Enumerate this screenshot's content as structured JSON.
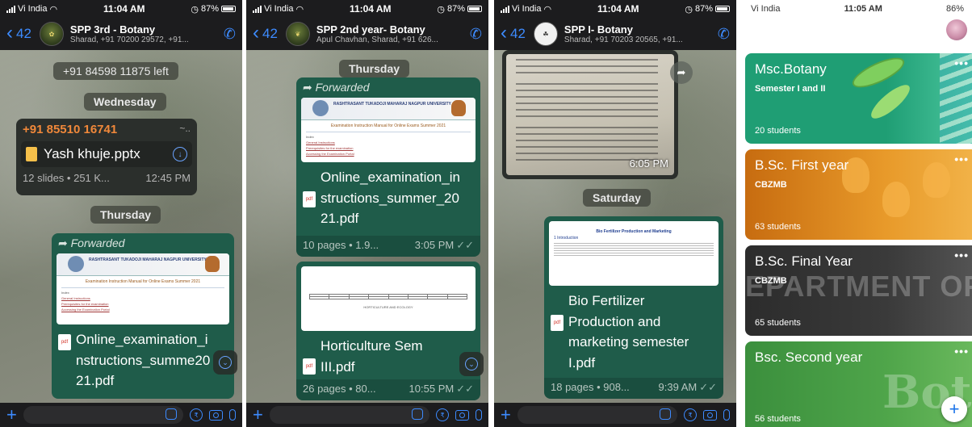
{
  "phone1": {
    "status": {
      "carrier": "Vi India",
      "time": "11:04 AM",
      "battery": "87%"
    },
    "header": {
      "back_count": "42",
      "title": "SPP 3rd - Botany",
      "subtitle": "Sharad, +91 70200 29572, +91..."
    },
    "system_msg": "+91 84598 11875 left",
    "day1": "Wednesday",
    "msg1": {
      "sender": "+91 85510 16741",
      "sender_extra": "~..",
      "file_name": "Yash khuje.pptx",
      "meta": "12 slides • 251 K...",
      "time": "12:45 PM"
    },
    "day2": "Thursday",
    "msg2": {
      "forwarded": "Forwarded",
      "file_name": "Online_examination_instructions_summe2021.pdf"
    }
  },
  "phone2": {
    "status": {
      "carrier": "Vi India",
      "time": "11:04 AM",
      "battery": "87%"
    },
    "header": {
      "back_count": "42",
      "title": "SPP 2nd year- Botany",
      "subtitle": "Apul Chavhan, Sharad, +91 626..."
    },
    "day1": "Thursday",
    "msg1": {
      "forwarded": "Forwarded",
      "file_name": "Online_examination_instructions_summer_2021.pdf",
      "meta": "10 pages • 1.9...",
      "time": "3:05 PM"
    },
    "msg2": {
      "file_name": "Horticulture Sem III.pdf",
      "meta": "26 pages • 80...",
      "time": "10:55 PM",
      "preview_heading": "HORTICULTURE AND ECOLOGY"
    }
  },
  "phone3": {
    "status": {
      "carrier": "Vi India",
      "time": "11:04 AM",
      "battery": "87%"
    },
    "header": {
      "back_count": "42",
      "title": "SPP I- Botany",
      "subtitle": "Sharad, +91 70203 20565, +91..."
    },
    "photo_time": "6:05 PM",
    "day1": "Saturday",
    "msg1": {
      "preview_title": "Bio Fertilizer Production and Marketing",
      "preview_sub": "1 Introduction",
      "file_name": "Bio Fertilizer Production and marketing semester I.pdf",
      "meta": "18 pages • 908...",
      "time": "9:39 AM"
    }
  },
  "classroom": {
    "status": {
      "carrier": "Vi India",
      "time": "11:05 AM",
      "battery": "86%"
    },
    "cards": [
      {
        "name": "Msc.Botany",
        "section": "Semester I and II",
        "count": "20 students"
      },
      {
        "name": "B.Sc. First year",
        "section": "CBZMB",
        "count": "63 students"
      },
      {
        "name": "B.Sc. Final Year",
        "section": "CBZMB",
        "count": "65 students",
        "watermark": "EPARTMENT OF BOTA"
      },
      {
        "name": "Bsc. Second year",
        "section": "",
        "count": "56 students",
        "watermark": "Bota"
      }
    ],
    "menu_glyph": "•••",
    "fab": "+"
  },
  "doc_preview": {
    "university": "RASHTRASANT TUKADOJI MAHARAJ NAGPUR UNIVERSITY",
    "title": "Examination Instruction Manual for Online Exams Summer 2021",
    "index": "Index",
    "link1": "General Instructions",
    "link2": "Prerequisites for the examination",
    "link3": "Accessing the Examination Portal"
  },
  "icons": {
    "pdf": "pdf"
  }
}
